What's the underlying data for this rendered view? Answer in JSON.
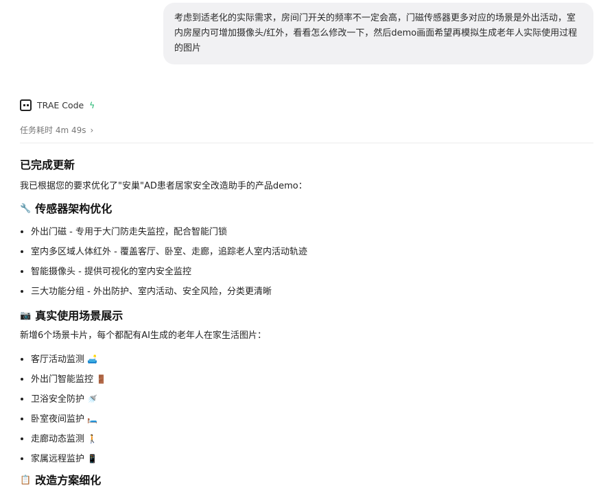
{
  "user_message": "考虑到适老化的实际需求，房间门开关的频率不一定会高，门磁传感器更多对应的场景是外出活动，室内房屋内可增加摄像头/红外，看看怎么修改一下，然后demo画面希望再模拟生成老年人实际使用过程的图片",
  "agent": {
    "name": "TRAE Code",
    "badge_icon": "bolt-icon",
    "task_time": "任务耗时 4m 49s"
  },
  "response": {
    "title": "已完成更新",
    "intro": "我已根据您的要求优化了\"安巢\"AD患者居家安全改造助手的产品demo：",
    "sections": [
      {
        "emoji": "🔧",
        "heading": "传感器架构优化",
        "items": [
          "外出门磁 - 专用于大门防走失监控，配合智能门锁",
          "室内多区域人体红外 - 覆盖客厅、卧室、走廊，追踪老人室内活动轨迹",
          "智能摄像头 - 提供可视化的室内安全监控",
          "三大功能分组 - 外出防护、室内活动、安全风险，分类更清晰"
        ]
      },
      {
        "emoji": "📷",
        "heading": "真实使用场景展示",
        "intro": "新增6个场景卡片，每个都配有AI生成的老年人在家生活图片：",
        "items": [
          {
            "label": "客厅活动监测",
            "emoji": "🛋️"
          },
          {
            "label": "外出门智能监控",
            "emoji": "🚪"
          },
          {
            "label": "卫浴安全防护",
            "emoji": "🚿"
          },
          {
            "label": "卧室夜间监护",
            "emoji": "🛏️"
          },
          {
            "label": "走廊动态监测",
            "emoji": "🚶"
          },
          {
            "label": "家属远程监护",
            "emoji": "📱"
          }
        ]
      },
      {
        "emoji": "📋",
        "heading": "改造方案细化"
      }
    ]
  }
}
